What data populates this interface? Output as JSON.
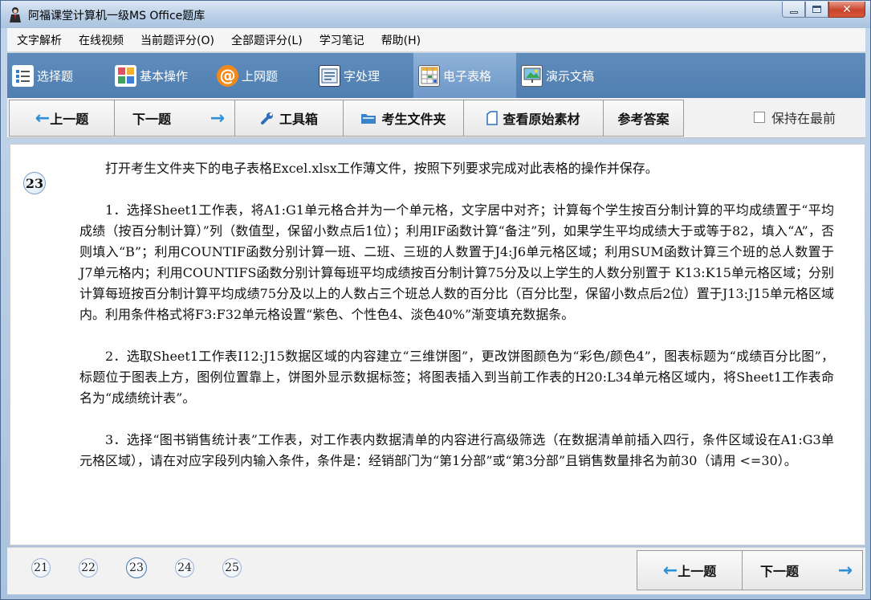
{
  "window": {
    "title": "阿福课堂计算机一级MS Office题库"
  },
  "menu": [
    "文字解析",
    "在线视频",
    "当前题评分(O)",
    "全部题评分(L)",
    "学习笔记",
    "帮助(H)"
  ],
  "modules": [
    {
      "label": "选择题",
      "icon": "list-icon"
    },
    {
      "label": "基本操作",
      "icon": "grid-icon"
    },
    {
      "label": "上网题",
      "icon": "at-icon"
    },
    {
      "label": "字处理",
      "icon": "document-icon"
    },
    {
      "label": "电子表格",
      "icon": "spreadsheet-icon",
      "active": true
    },
    {
      "label": "演示文稿",
      "icon": "presentation-icon"
    }
  ],
  "toolbar": {
    "prev": "上一题",
    "next": "下一题",
    "toolbox": "工具箱",
    "student_folder": "考生文件夹",
    "view_material": "查看原始素材",
    "reference_answer": "参考答案",
    "keep_on_top": "保持在最前"
  },
  "question": {
    "number": "23",
    "intro": "打开考生文件夹下的电子表格Excel.xlsx工作薄文件，按照下列要求完成对此表格的操作并保存。",
    "item1": "1．选择Sheet1工作表，将A1:G1单元格合并为一个单元格，文字居中对齐；计算每个学生按百分制计算的平均成绩置于“平均成绩（按百分制计算）”列（数值型，保留小数点后1位）；利用IF函数计算“备注”列，如果学生平均成绩大于或等于82，填入“A”，否则填入“B”；利用COUNTIF函数分别计算一班、二班、三班的人数置于J4:J6单元格区域；利用SUM函数计算三个班的总人数置于J7单元格内；利用COUNTIFS函数分别计算每班平均成绩按百分制计算75分及以上学生的人数分别置于 K13:K15单元格区域；分别计算每班按百分制计算平均成绩75分及以上的人数占三个班总人数的百分比（百分比型，保留小数点后2位）置于J13:J15单元格区域内。利用条件格式将F3:F32单元格设置“紫色、个性色4、淡色40%”渐变填充数据条。",
    "item2": "2．选取Sheet1工作表I12:J15数据区域的内容建立“三维饼图”，更改饼图颜色为“彩色/颜色4”，图表标题为“成绩百分比图”，标题位于图表上方，图例位置靠上，饼图外显示数据标签；将图表插入到当前工作表的H20:L34单元格区域内，将Sheet1工作表命名为“成绩统计表”。",
    "item3": "3．选择“图书销售统计表”工作表，对工作表内数据清单的内容进行高级筛选（在数据清单前插入四行，条件区域设在A1:G3单元格区域），请在对应字段列内输入条件，条件是：经销部门为“第1分部”或“第3分部”且销售数量排名为前30（请用 <=30）。"
  },
  "pager": {
    "pages": [
      "21",
      "22",
      "23",
      "24",
      "25"
    ],
    "current": "23",
    "prev": "上一题",
    "next": "下一题"
  }
}
